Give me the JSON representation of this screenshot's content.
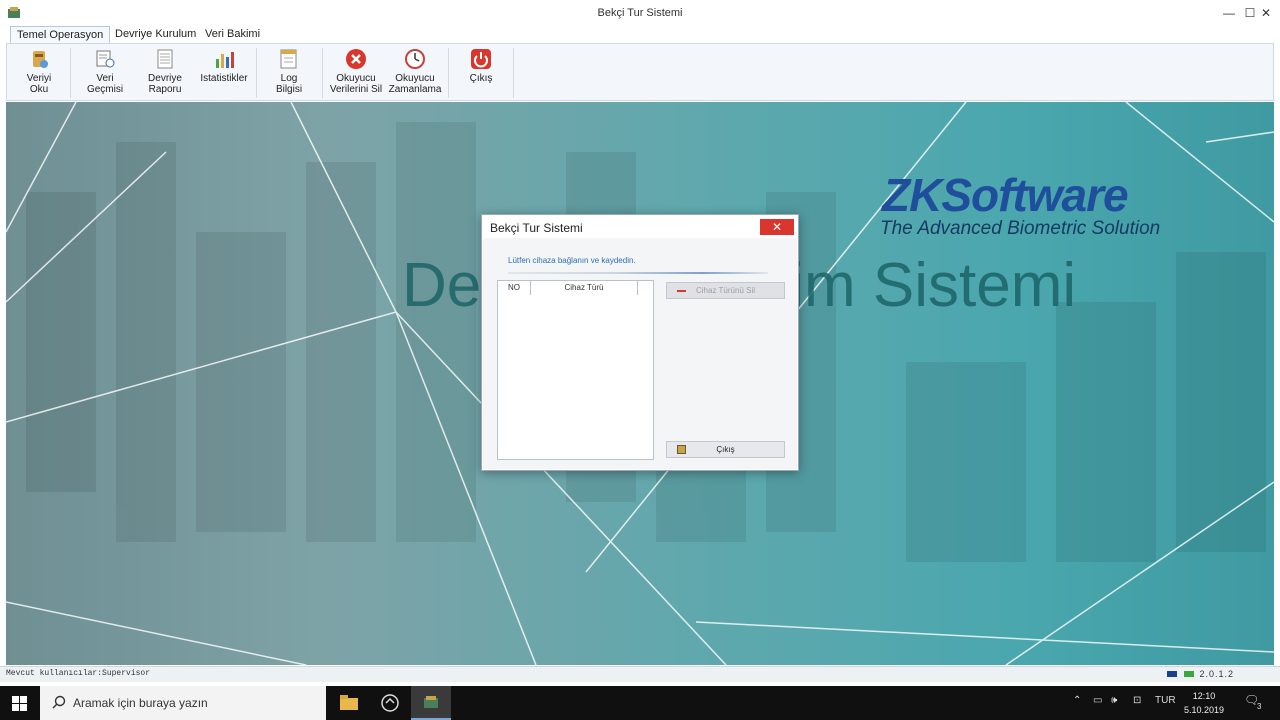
{
  "window": {
    "title": "Bekçi Tur Sistemi",
    "controls": {
      "minimize": "—",
      "maximize": "☐",
      "close": "✕"
    }
  },
  "ribbon_tabs": [
    {
      "label": "Temel Operasyon",
      "active": true
    },
    {
      "label": "Devriye Kurulum",
      "active": false
    },
    {
      "label": "Veri Bakimi",
      "active": false
    }
  ],
  "ribbon_buttons": {
    "read_data": {
      "line1": "Veriyi",
      "line2": "Oku",
      "icon": "database-read-icon"
    },
    "data_history": {
      "line1": "Veri",
      "line2": "Geçmisi",
      "icon": "history-icon"
    },
    "patrol_report": {
      "line1": "Devriye",
      "line2": "Raporu",
      "icon": "report-icon"
    },
    "statistics": {
      "line1": "Istatistikler",
      "line2": "",
      "icon": "bar-chart-icon"
    },
    "log_info": {
      "line1": "Log",
      "line2": "Bilgisi",
      "icon": "log-icon"
    },
    "delete_reader_data": {
      "line1": "Okuyucu",
      "line2": "Verilerini Sil",
      "icon": "delete-icon"
    },
    "reader_time": {
      "line1": "Okuyucu",
      "line2": "Zamanlama",
      "icon": "clock-icon"
    },
    "exit": {
      "line1": "Çıkış",
      "line2": "",
      "icon": "power-icon"
    }
  },
  "background": {
    "logo": "ZKSoftware",
    "tagline": "The Advanced Biometric Solution",
    "title": "Devriye Yönetim Sistemi"
  },
  "statusbar": {
    "user": "Mevcut kullanıcılar:Supervisor",
    "version": "2.0.1.2"
  },
  "dialog": {
    "title": "Bekçi Tur Sistemi",
    "close": "✕",
    "message": "Lütfen cihaza bağlanın ve kaydedin.",
    "columns": [
      "NO",
      "Cihaz Türü"
    ],
    "rows": [],
    "delete_button": "Cihaz Türünü Sil",
    "exit_button": "Çıkış"
  },
  "taskbar": {
    "search_placeholder": "Aramak için buraya yazın",
    "language": "TUR",
    "time": "12:10",
    "date": "5.10.2019",
    "notifications": "3"
  },
  "colors": {
    "accent_blue": "#1f4f9c",
    "close_red": "#d9372e",
    "teal_background": "#4aa7ae"
  }
}
